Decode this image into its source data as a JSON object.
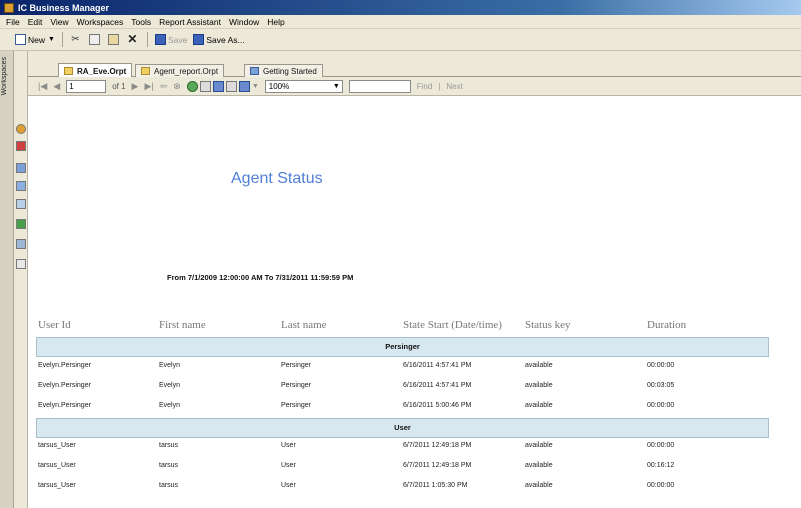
{
  "window": {
    "title": "IC Business Manager"
  },
  "menu": [
    "File",
    "Edit",
    "View",
    "Workspaces",
    "Tools",
    "Report Assistant",
    "Window",
    "Help"
  ],
  "toolbar": {
    "new_label": "New",
    "save_label": "Save",
    "save_as_label": "Save As..."
  },
  "workspace_rail": {
    "label": "Workspaces"
  },
  "tabs": [
    "RA_Eve.Orpt",
    "Agent_report.Orpt",
    "Getting Started"
  ],
  "report_toolbar": {
    "page_current": "1",
    "page_of": "of 1",
    "zoom": "100%",
    "find_label": "Find",
    "next_label": "Next"
  },
  "report": {
    "title": "Agent Status",
    "date_range": "From 7/1/2009 12:00:00 AM  To 7/31/2011 11:59:59 PM",
    "columns": [
      "User Id",
      "First name",
      "Last name",
      "State Start (Date/time)",
      "Status key",
      "Duration"
    ],
    "groups": [
      {
        "name": "Persinger",
        "rows": [
          [
            "Evelyn.Persinger",
            "Evelyn",
            "Persinger",
            "6/16/2011 4:57:41 PM",
            "available",
            "00:00:00"
          ],
          [
            "Evelyn.Persinger",
            "Evelyn",
            "Persinger",
            "6/16/2011 4:57:41 PM",
            "available",
            "00:03:05"
          ],
          [
            "Evelyn.Persinger",
            "Evelyn",
            "Persinger",
            "6/16/2011 5:00:46 PM",
            "available",
            "00:00:00"
          ]
        ]
      },
      {
        "name": "User",
        "rows": [
          [
            "tarsus_User",
            "tarsus",
            "User",
            "6/7/2011 12:49:18 PM",
            "available",
            "00:00:00"
          ],
          [
            "tarsus_User",
            "tarsus",
            "User",
            "6/7/2011 12:49:18 PM",
            "available",
            "00:16:12"
          ],
          [
            "tarsus_User",
            "tarsus",
            "User",
            "6/7/2011 1:05:30 PM",
            "available",
            "00:00:00"
          ]
        ]
      }
    ]
  }
}
